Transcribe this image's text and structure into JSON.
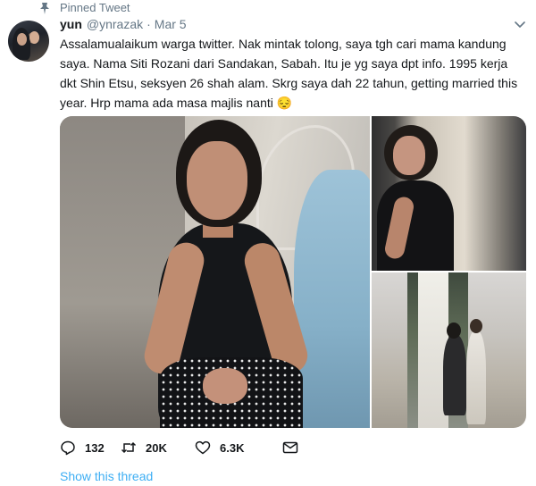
{
  "pinned": {
    "label": "Pinned Tweet",
    "icon": "pin-icon"
  },
  "author": {
    "name": "yun",
    "handle": "@ynrazak",
    "separator": "·",
    "date": "Mar 5"
  },
  "tweet": {
    "text": "Assalamualaikum warga twitter. Nak mintak tolong, saya tgh cari mama kandung saya. Nama Siti Rozani dari Sandakan, Sabah. Itu je yg saya dpt info. 1995 kerja dkt Shin Etsu, seksyen 26 shah alam. Skrg saya dah 22 tahun, getting married this year. Hrp mama ada masa majlis nanti 😔"
  },
  "actions": {
    "replies": "132",
    "retweets": "20K",
    "likes": "6.3K"
  },
  "show_thread": "Show this thread",
  "colors": {
    "text": "#14171a",
    "secondary": "#657786",
    "link": "#1da1f2"
  }
}
